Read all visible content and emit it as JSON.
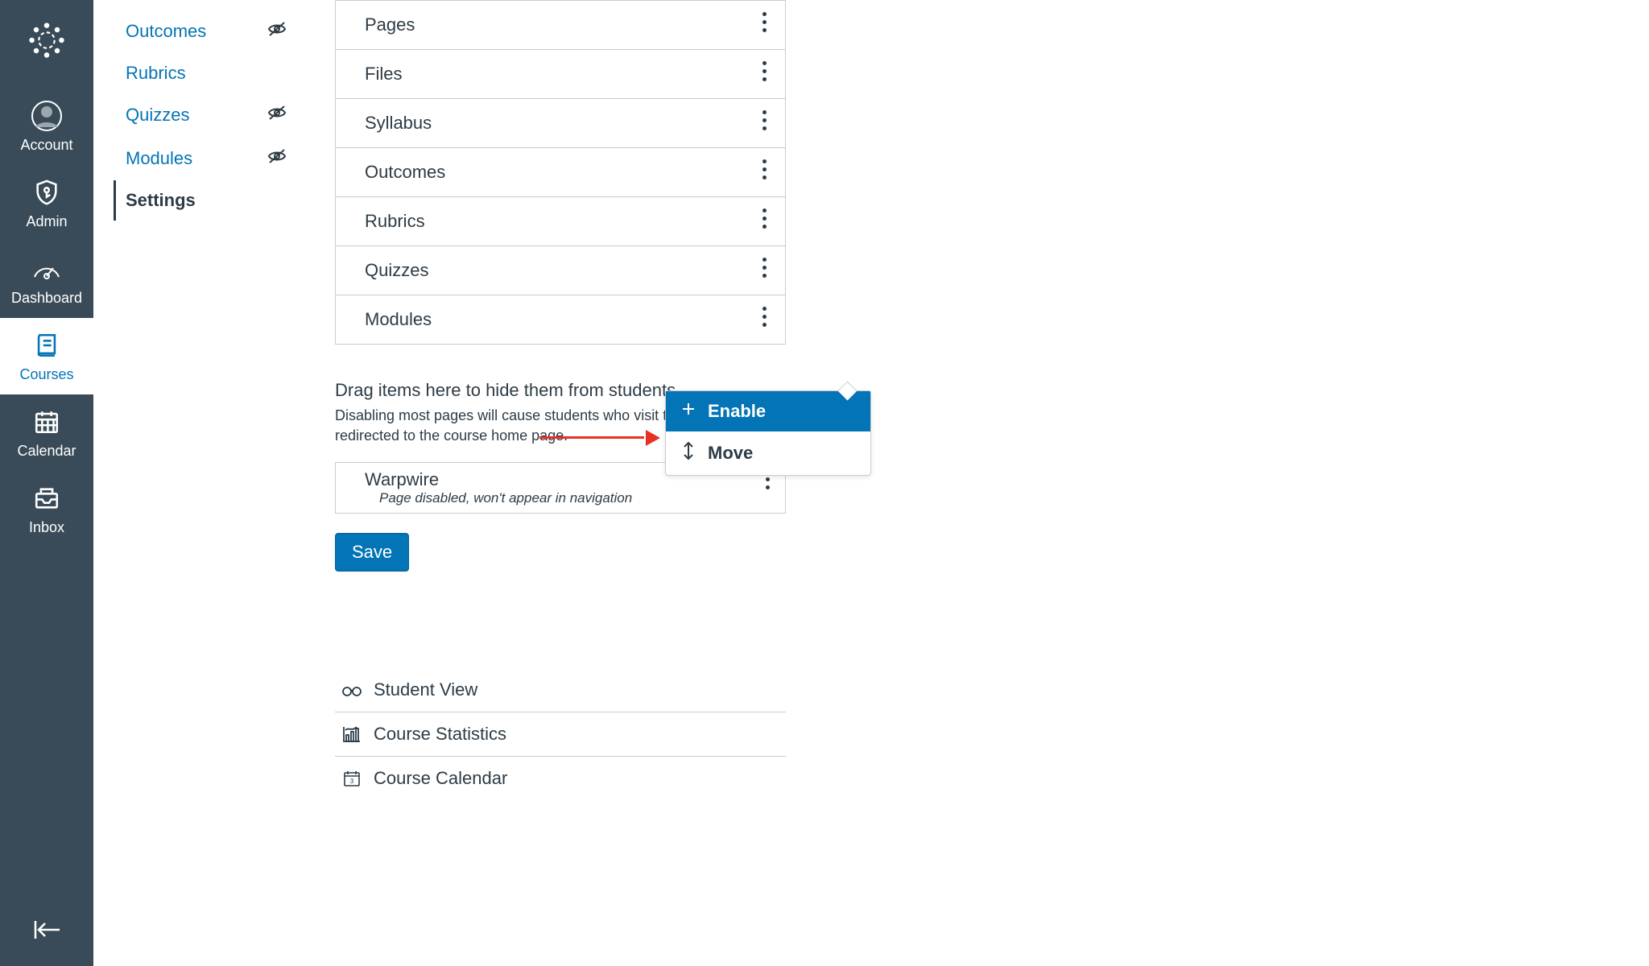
{
  "global_nav": {
    "account": "Account",
    "admin": "Admin",
    "dashboard": "Dashboard",
    "courses": "Courses",
    "calendar": "Calendar",
    "inbox": "Inbox"
  },
  "course_nav": {
    "outcomes": "Outcomes",
    "rubrics": "Rubrics",
    "quizzes": "Quizzes",
    "modules": "Modules",
    "settings": "Settings"
  },
  "nav_items": {
    "pages": "Pages",
    "files": "Files",
    "syllabus": "Syllabus",
    "outcomes": "Outcomes",
    "rubrics": "Rubrics",
    "quizzes": "Quizzes",
    "modules": "Modules"
  },
  "hidden_section": {
    "heading": "Drag items here to hide them from students.",
    "sub": "Disabling most pages will cause students who visit those pages to be redirected to the course home page.",
    "item_title": "Warpwire",
    "item_sub": "Page disabled, won't appear in navigation"
  },
  "buttons": {
    "save": "Save"
  },
  "popup": {
    "enable": "Enable",
    "move": "Move"
  },
  "side_links": {
    "student_view": "Student View",
    "course_statistics": "Course Statistics",
    "course_calendar": "Course Calendar"
  }
}
